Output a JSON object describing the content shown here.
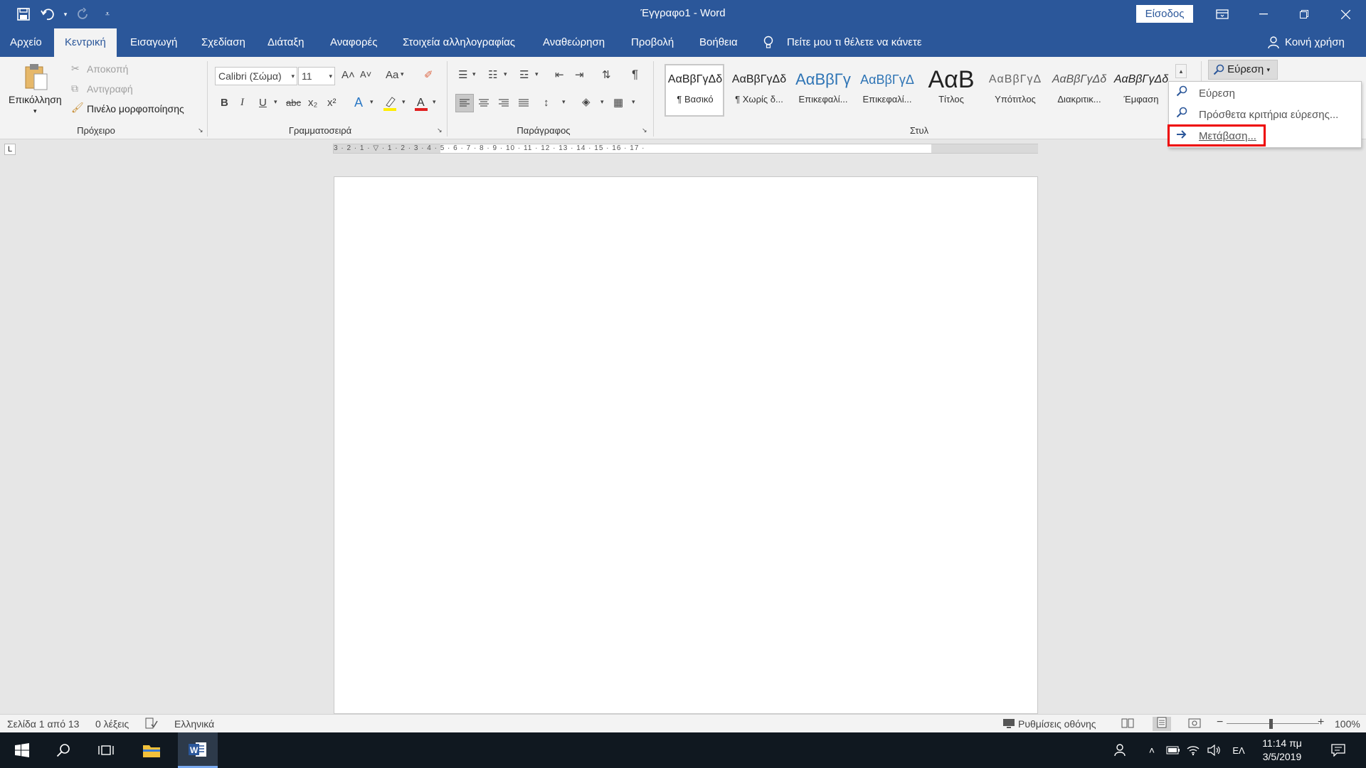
{
  "title_bar": {
    "title": "Έγγραφο1  -  Word",
    "signin_label": "Είσοδος"
  },
  "tabs": [
    "Αρχείο",
    "Κεντρική",
    "Εισαγωγή",
    "Σχεδίαση",
    "Διάταξη",
    "Αναφορές",
    "Στοιχεία αλληλογραφίας",
    "Αναθεώρηση",
    "Προβολή",
    "Βοήθεια"
  ],
  "active_tab": "Κεντρική",
  "tell_me": "Πείτε μου τι θέλετε να κάνετε",
  "share": "Κοινή χρήση",
  "clipboard": {
    "paste": "Επικόλληση",
    "cut": "Αποκοπή",
    "copy": "Αντιγραφή",
    "format_painter": "Πινέλο μορφοποίησης",
    "label": "Πρόχειρο"
  },
  "font": {
    "name": "Calibri (Σώμα)",
    "size": "11",
    "label": "Γραμματοσειρά",
    "case": "Aa",
    "bold": "B",
    "italic": "I",
    "underline": "U",
    "strike": "abc",
    "sub": "x₂",
    "sup": "x²",
    "grow": "A˄",
    "shrink": "A˅"
  },
  "paragraph": {
    "label": "Παράγραφος",
    "pilcrow": "¶"
  },
  "styles": {
    "label": "Στυλ",
    "items": [
      {
        "preview": "ΑαΒβΓγΔδ",
        "name": "¶ Βασικό"
      },
      {
        "preview": "ΑαΒβΓγΔδ",
        "name": "¶ Χωρίς δ..."
      },
      {
        "preview": "ΑαΒβΓγ",
        "name": "Επικεφαλί..."
      },
      {
        "preview": "ΑαΒβΓγΔ",
        "name": "Επικεφαλί..."
      },
      {
        "preview": "ΑαΒ",
        "name": "Τίτλος"
      },
      {
        "preview": "ΑαΒβΓγΔ",
        "name": "Υπότιτλος"
      },
      {
        "preview": "ΑαΒβΓγΔδ",
        "name": "Διακριτικ..."
      },
      {
        "preview": "ΑαΒβΓγΔδ",
        "name": "Έμφαση"
      }
    ]
  },
  "find": {
    "button_label": "Εύρεση",
    "menu": [
      {
        "icon": "search-icon",
        "label": "Εύρεση"
      },
      {
        "icon": "search-icon",
        "label": "Πρόσθετα κριτήρια εύρεσης..."
      },
      {
        "icon": "arrow-right-icon",
        "label": "Μετάβαση..."
      }
    ]
  },
  "ruler": {
    "marks": "3 · 2 · 1 · ▽ · 1 · 2 · 3 · 4 · 5 · 6 · 7 · 8 · 9 · 10 · 11 · 12 · 13 · 14 · 15 · 16 · 17 ·",
    "tab_selector": "L"
  },
  "status": {
    "page": "Σελίδα 1 από 13",
    "words": "0 λέξεις",
    "language": "Ελληνικά",
    "display_settings": "Ρυθμίσεις οθόνης",
    "zoom": "100%",
    "zoom_minus": "−",
    "zoom_plus": "+"
  },
  "taskbar": {
    "time": "11:14 πμ",
    "date": "3/5/2019",
    "lang": "ΕΛ"
  },
  "colors": {
    "brand": "#2b579a",
    "highlight_border": "#e00000",
    "taskbar": "#101820"
  }
}
